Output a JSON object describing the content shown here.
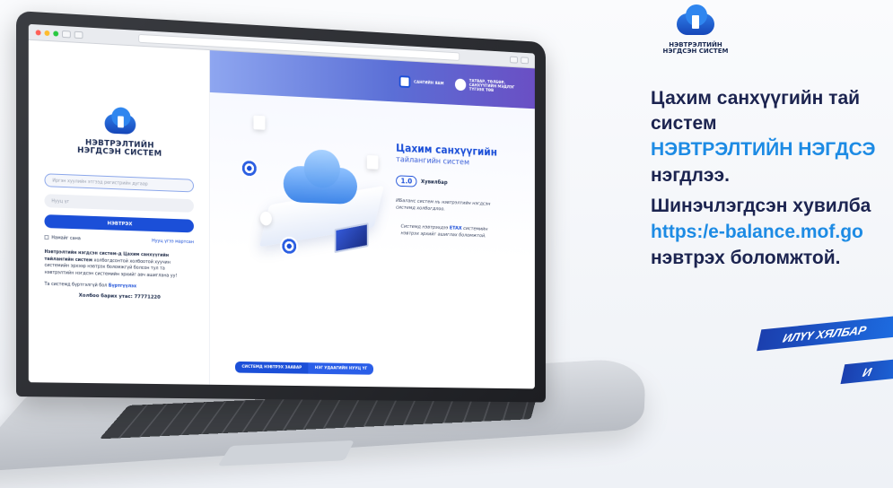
{
  "login": {
    "logo_line1": "НЭВТРЭЛТИЙН",
    "logo_line2": "НЭГДСЭН СИСТЕМ",
    "register_placeholder": "Иргэн хуулийн этгээд регистрийн дугаар",
    "password_placeholder": "Нууц үг",
    "login_button": "НЭВТРЭХ",
    "remember_label": "Намайг сана",
    "forgot_link": "Нууц үгээ мартсан",
    "info_bold": "Нэвтрэлтийн нэгдсэн систем-д Цахим санхүүгийн тайлангийн систем",
    "info_rest": "холбогдсонтой холбоотой хуучин системийн эрхээр нэвтрэх боломжгүй болсон тул та нэвтрэлтийн нэгдсэн системийн эрхийг авч ашиглана уу!",
    "register_text": "Та системд бүртгэлгүй бол",
    "register_link": "Бүртгүүлэх",
    "phone": "Холбоо барих утас: 77771220"
  },
  "hero": {
    "ministry1": "САНГИЙН ЯАМ",
    "ministry2": "ТАТВАР, ТӨЛБӨР, САНХҮҮГИЙН МЭДЛЭГ ТҮГЭЭХ ТӨВ",
    "title": "Цахим санхүүгийн",
    "subtitle": "тайлангийн систем",
    "version_number": "1.0",
    "version_label": "Хувилбар",
    "p1": "ИБаланс систем нь нэвтрэлтийн нэгдсэн системд холбогдлоо.",
    "p2_pre": "Системд нэвтрэхдээ",
    "p2_bold": "ETAX",
    "p2_post": "системийн нэвтрэх эрхийг ашиглах боломжтой.",
    "btn_guide": "СИСТЕМД НЭВТРЭХ ЗААВАР",
    "btn_once": "НЭГ УДААГИЙН НУУЦ ҮГ"
  },
  "right": {
    "logo_line1": "НЭВТРЭЛТИЙН",
    "logo_line2": "НЭГДСЭН СИСТЕМ",
    "line1": "Цахим санхүүгийн тай",
    "line2": "систем",
    "line3": "НЭВТРЭЛТИЙН НЭГДСЭ",
    "line4": "нэгдлээ.",
    "line5": "Шинэчлэгдсэн хувилба",
    "line6": "https:/e-balance.mof.go",
    "line7": "нэвтрэх боломжтой.",
    "ribbon1": "ИЛҮҮ ХЯЛБАР",
    "ribbon2": "И"
  },
  "colors": {
    "accent": "#1b4fd8",
    "highlight": "#1d8be4",
    "dark": "#1c2450"
  }
}
